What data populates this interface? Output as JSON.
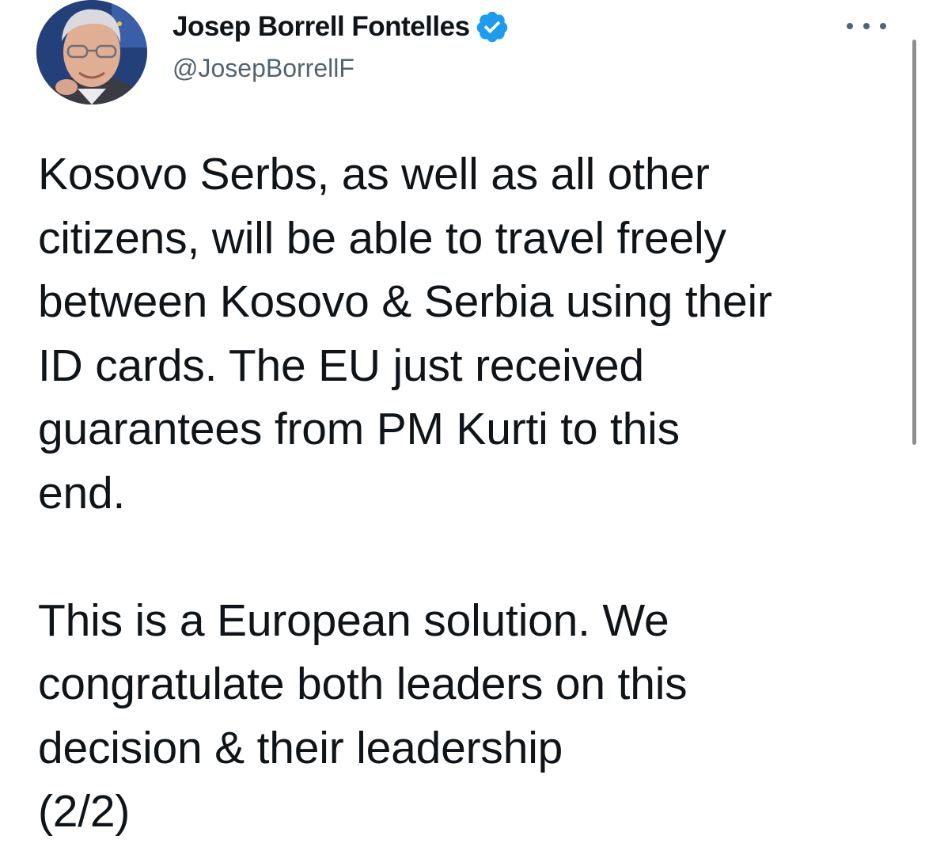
{
  "tweet": {
    "author": {
      "name": "Josep Borrell Fontelles",
      "handle": "@JosepBorrellF",
      "verified_icon": "verified-badge-icon",
      "avatar_icon": "profile-photo"
    },
    "more_icon": "more-options-icon",
    "text_paragraph_1": "Kosovo Serbs, as well as all other\ncitizens, will be able to travel freely\nbetween Kosovo & Serbia using their\nID cards. The EU just received\nguarantees from PM Kurti to this\nend.",
    "text_paragraph_2": "This is a European solution. We\ncongratulate both leaders on this\ndecision & their leadership\n(2/2)"
  },
  "colors": {
    "text": "#0f1419",
    "secondary_text": "#536471",
    "verified_blue": "#1d9bf0",
    "background": "#ffffff"
  }
}
